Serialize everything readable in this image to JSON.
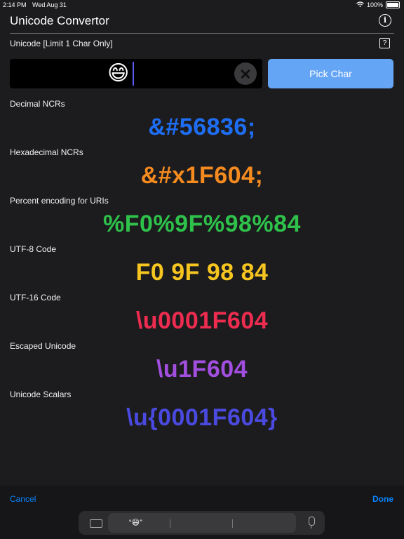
{
  "status_bar": {
    "time": "2:14 PM",
    "date": "Wed Aug 31",
    "battery": "100%",
    "wifi_icon": "wifi-icon",
    "battery_icon": "battery-icon"
  },
  "header": {
    "title": "Unicode Convertor",
    "info_icon": "info-icon"
  },
  "input_section": {
    "label": "Unicode [Limit 1 Char Only]",
    "help_icon": "question-mark-icon",
    "value": "😄",
    "clear_icon": "clear-icon",
    "pick_button": "Pick Char"
  },
  "conversions": [
    {
      "label": "Decimal NCRs",
      "value": "&#56836;",
      "color": "#1e6ef5"
    },
    {
      "label": "Hexadecimal NCRs",
      "value": "&#x1F604;",
      "color": "#f58a1f"
    },
    {
      "label": "Percent encoding for URIs",
      "value": "%F0%9F%98%84",
      "color": "#2fc24b"
    },
    {
      "label": "UTF-8 Code",
      "value": "F0 9F 98 84",
      "color": "#f7c520"
    },
    {
      "label": "UTF-16 Code",
      "value": "\\u0001F604",
      "color": "#ee2c50"
    },
    {
      "label": "Escaped Unicode",
      "value": "\\u1F604",
      "color": "#a24fe0"
    },
    {
      "label": "Unicode Scalars",
      "value": "\\u{0001F604}",
      "color": "#4a4ae0"
    }
  ],
  "keyboard_bar": {
    "cancel": "Cancel",
    "done": "Done",
    "suggestion": "“😄”",
    "keyboard_icon": "keyboard-icon",
    "mic_icon": "microphone-icon"
  }
}
